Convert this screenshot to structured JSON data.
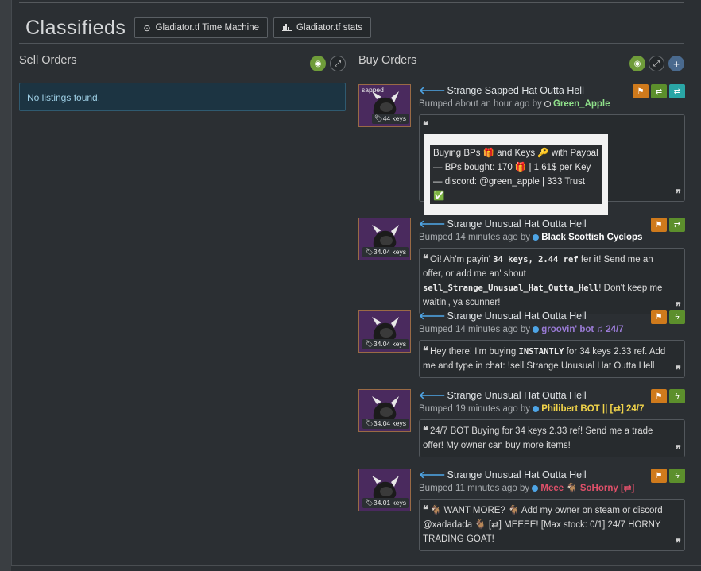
{
  "header": {
    "title": "Classifieds",
    "time_machine_label": "Gladiator.tf Time Machine",
    "stats_label": "Gladiator.tf stats"
  },
  "sell": {
    "title": "Sell Orders",
    "empty_text": "No listings found."
  },
  "buy": {
    "title": "Buy Orders",
    "listings": [
      {
        "thumb_label": "sapped",
        "price": "44 keys",
        "title": "Strange Sapped Hat Outta Hell",
        "bumped": "Bumped about an hour ago by",
        "user": "Green_Apple",
        "user_color": "#8fe08a",
        "desc_lines": [
          "Buying BPs 🎁 and Keys 🔑 with Paypal",
          "— BPs bought: 170 🎁 | 1.61$ per Key",
          "— discord: @green_apple | 333 Trust ✅"
        ]
      },
      {
        "price": "34.04 keys",
        "title": "Strange Unusual Hat Outta Hell",
        "bumped": "Bumped 14 minutes ago by",
        "user": "Black Scottish Cyclops",
        "user_color": "#ffffff",
        "desc_pre": "Oi! Ah'm payin'",
        "desc_bold1": "34 keys, 2.44 ref",
        "desc_mid": "fer it! Send me an offer, or add me an' shout",
        "desc_bold2": "sell_Strange_Unusual_Hat_Outta_Hell",
        "desc_post": "! Don't keep me waitin', ya scunner!"
      },
      {
        "price": "34.04 keys",
        "title": "Strange Unusual Hat Outta Hell",
        "bumped": "Bumped 14 minutes ago by",
        "user": "groovin' bot ♫ 24/7",
        "user_color": "#9a7bd6",
        "desc_pre": "Hey there! I'm buying",
        "desc_bold": "INSTANTLY",
        "desc_post": "for 34 keys 2.33 ref. Add me and type in chat: !sell Strange Unusual Hat Outta Hell"
      },
      {
        "price": "34.04 keys",
        "title": "Strange Unusual Hat Outta Hell",
        "bumped": "Bumped 19 minutes ago by",
        "user": "Philibert BOT || [⇄] 24/7",
        "user_color": "#f0d34a",
        "desc_text": "24/7 BOT Buying for 34 keys 2.33 ref! Send me a trade offer! My owner can buy more items!"
      },
      {
        "price": "34.01 keys",
        "title": "Strange Unusual Hat Outta Hell",
        "bumped": "Bumped 11 minutes ago by",
        "user": "Meee 🐐 SoHorny [⇄]",
        "user_color": "#e0506a",
        "desc_text": "🐐 WANT MORE? 🐐 Add my owner on steam or discord @xadadada 🐐 [⇄] MEEEE! [Max stock: 0/1] 24/7 HORNY TRADING GOAT!"
      }
    ]
  },
  "colors": {
    "flag": "#cf7a1c",
    "trade": "#5c8f2c",
    "teal": "#2aa6a6",
    "link_arrow": "#4ea5e6"
  }
}
